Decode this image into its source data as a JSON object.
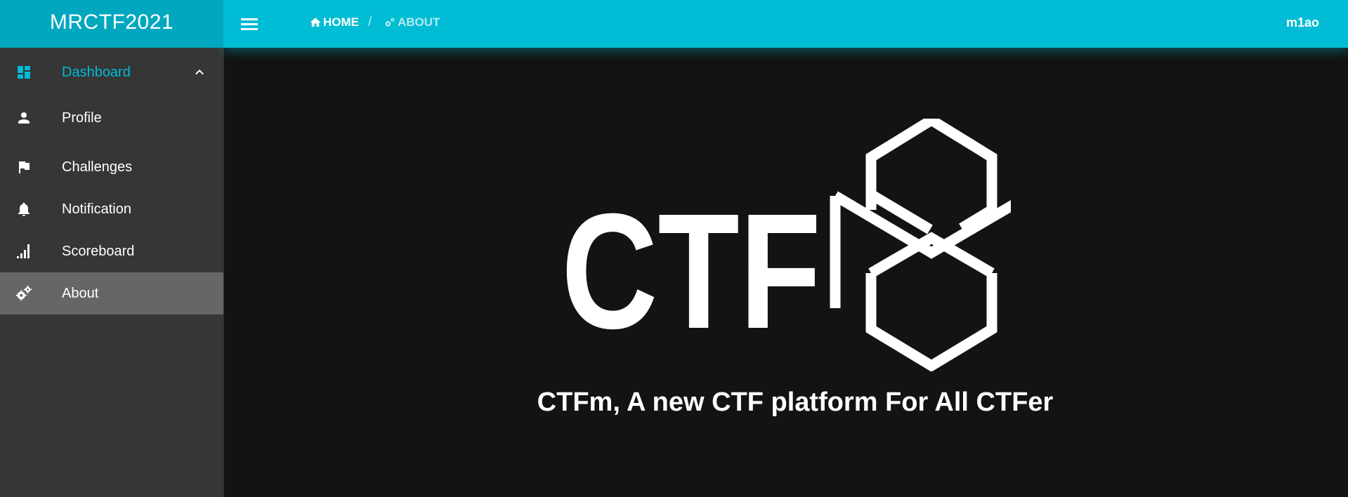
{
  "sidebar": {
    "brand": "MRCTF2021",
    "items": [
      {
        "label": "Dashboard",
        "icon": "dashboard-icon"
      },
      {
        "label": "Profile",
        "icon": "person-icon"
      },
      {
        "label": "Challenges",
        "icon": "flag-icon"
      },
      {
        "label": "Notification",
        "icon": "bell-icon"
      },
      {
        "label": "Scoreboard",
        "icon": "signal-bars-icon"
      },
      {
        "label": "About",
        "icon": "gears-icon"
      }
    ]
  },
  "topbar": {
    "breadcrumb": {
      "home": "HOME",
      "separator": "/",
      "current": "ABOUT"
    },
    "user": "m1ao"
  },
  "main": {
    "logo_text": "CTF",
    "tagline": "CTFm, A new CTF platform For All CTFer"
  },
  "colors": {
    "accent": "#00bcd4",
    "brand_bg": "#00a7bf",
    "sidebar_bg": "#363636",
    "selected_bg": "#666666",
    "content_bg": "#131313"
  }
}
